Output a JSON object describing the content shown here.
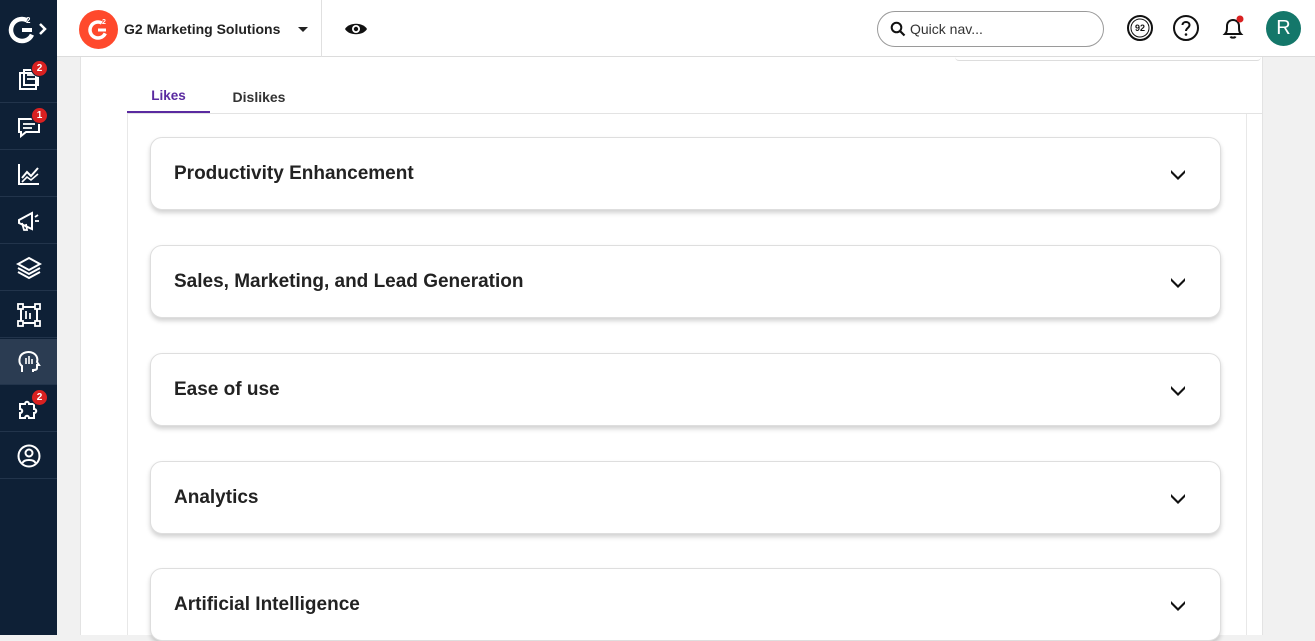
{
  "sidebar": {
    "items": [
      {
        "name": "listing-icon",
        "badge": "2"
      },
      {
        "name": "reviews-icon",
        "badge": "1"
      },
      {
        "name": "analytics-icon",
        "badge": ""
      },
      {
        "name": "megaphone-icon",
        "badge": ""
      },
      {
        "name": "layers-icon",
        "badge": ""
      },
      {
        "name": "report-icon",
        "badge": ""
      },
      {
        "name": "ai-insights-icon",
        "badge": "",
        "active": true
      },
      {
        "name": "integrations-icon",
        "badge": "2"
      },
      {
        "name": "account-icon",
        "badge": ""
      }
    ]
  },
  "header": {
    "company": "G2 Marketing Solutions",
    "search_placeholder": "Quick nav...",
    "score": "92",
    "avatar_initial": "R"
  },
  "tabs": [
    {
      "label": "Likes",
      "active": true
    },
    {
      "label": "Dislikes",
      "active": false
    }
  ],
  "cards": [
    {
      "title": "Productivity Enhancement"
    },
    {
      "title": "Sales, Marketing, and Lead Generation"
    },
    {
      "title": "Ease of use"
    },
    {
      "title": "Analytics"
    },
    {
      "title": "Artificial Intelligence"
    }
  ],
  "colors": {
    "sidebar": "#0e2036",
    "brand": "#ff492c",
    "accent": "#5a2aa0",
    "badge": "#d92121",
    "avatar": "#14776a"
  }
}
